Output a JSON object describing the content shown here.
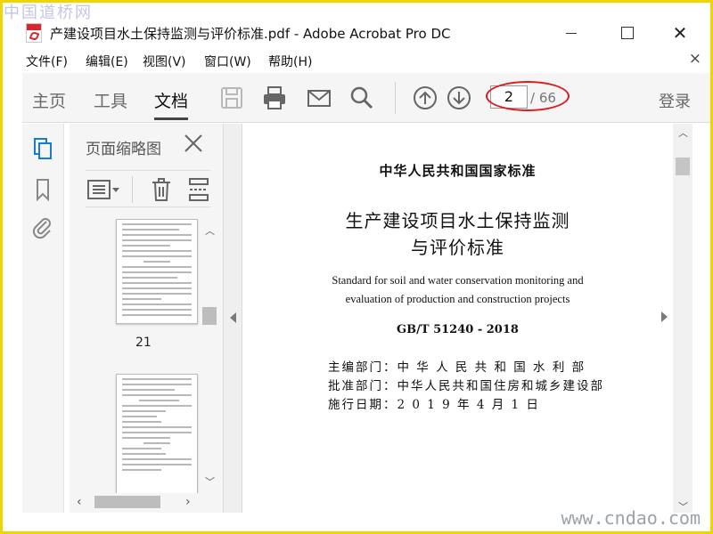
{
  "watermark": {
    "top_left": "中国道桥网",
    "bottom_right": "www.cndao.com"
  },
  "window": {
    "title": "产建设项目水土保持监测与评价标准.pdf - Adobe Acrobat Pro DC",
    "close_glyph": "✕"
  },
  "menu": {
    "items": [
      {
        "label": "文件(F)"
      },
      {
        "label": "编辑(E)"
      },
      {
        "label": "视图(V)"
      },
      {
        "label": "窗口(W)"
      },
      {
        "label": "帮助(H)"
      }
    ],
    "close_glyph": "×"
  },
  "toolbar": {
    "tabs": [
      {
        "label": "主页",
        "active": false
      },
      {
        "label": "工具",
        "active": false
      },
      {
        "label": "文档",
        "active": true
      }
    ],
    "page_number": "2",
    "page_total": "/ 66",
    "login": "登录",
    "highlight_color": "#e01a1a"
  },
  "thumbnails": {
    "title": "页面缩略图",
    "pages": [
      {
        "label": "21"
      }
    ]
  },
  "document": {
    "standard_label": "中华人民共和国国家标准",
    "title_line1": "生产建设项目水土保持监测",
    "title_line2": "与评价标准",
    "english_line1": "Standard for soil and water conservation monitoring and",
    "english_line2": "evaluation of production and construction projects",
    "code": "GB/T 51240 - 2018",
    "info": [
      "主编部门：中 华 人 民 共 和 国 水 利 部",
      "批准部门：中华人民共和国住房和城乡建设部",
      "施行日期：2 0 1 9 年 4 月 1 日"
    ]
  },
  "colors": {
    "frame": "#f2d500",
    "toolbar_bg": "#f5f5f5",
    "acrobat_icon_blue": "#1a7bd6"
  }
}
